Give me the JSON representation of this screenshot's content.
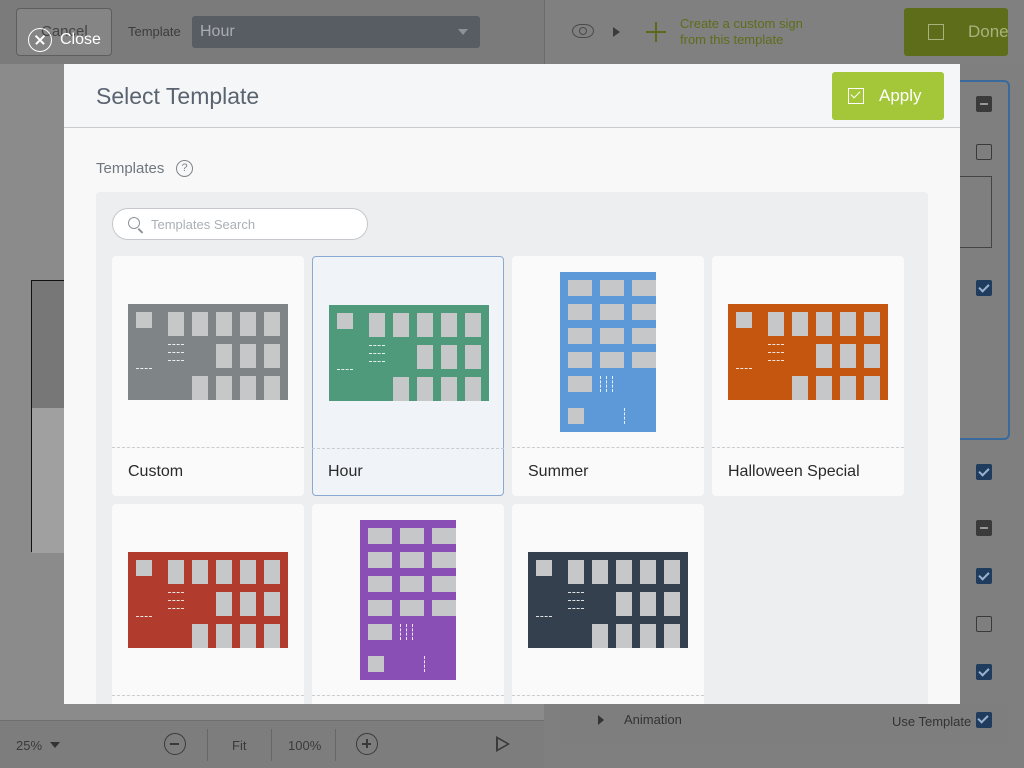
{
  "background": {
    "cancel_label": "Cancel",
    "close_label": "Close",
    "template_label": "Template",
    "template_value": "Hour",
    "create_custom_line1": "Create a custom sign",
    "create_custom_line2": "from this template",
    "done_label": "Done",
    "zoom_level": "25%",
    "fit_label": "Fit",
    "hundred_label": "100%",
    "animation_label": "Animation",
    "use_template_label": "Use Template"
  },
  "modal": {
    "title": "Select Template",
    "apply_label": "Apply",
    "section_label": "Templates",
    "help_glyph": "?",
    "search_placeholder": "Templates Search",
    "templates": [
      {
        "name": "Custom",
        "color": "#7f8487",
        "layout": "horizontal",
        "selected": false
      },
      {
        "name": "Hour",
        "color": "#4e9a7b",
        "layout": "horizontal",
        "selected": true
      },
      {
        "name": "Summer",
        "color": "#5d98d8",
        "layout": "vertical",
        "selected": false
      },
      {
        "name": "Halloween Special",
        "color": "#c4560f",
        "layout": "horizontal",
        "selected": false
      },
      {
        "name": "",
        "color": "#b13b2d",
        "layout": "horizontal",
        "selected": false
      },
      {
        "name": "",
        "color": "#8a4fb5",
        "layout": "vertical",
        "selected": false
      },
      {
        "name": "",
        "color": "#34404e",
        "layout": "horizontal",
        "selected": false
      }
    ]
  },
  "icons": {
    "close": "close-icon",
    "apply": "checkbox-icon",
    "done": "checkbox-icon",
    "search": "search-icon",
    "help": "help-icon",
    "preview": "eye-icon",
    "add": "plus-icon"
  },
  "colors": {
    "apply_green": "#a4c639",
    "selected_border": "#8aa9d0",
    "modal_bg": "#f8f8f8"
  }
}
